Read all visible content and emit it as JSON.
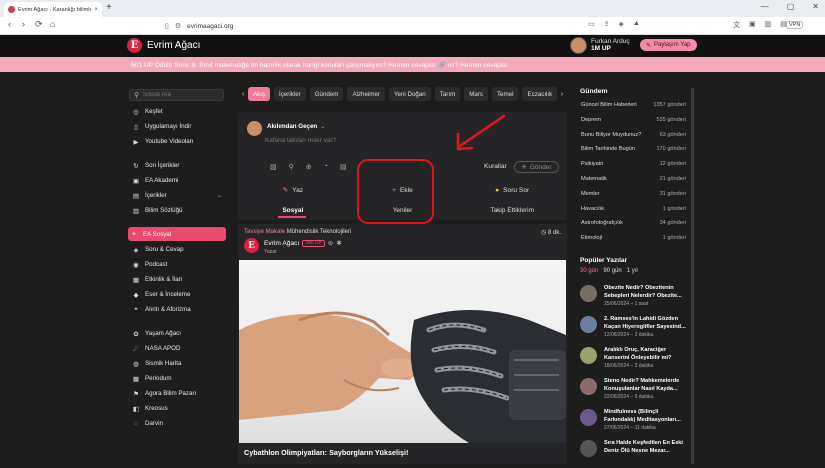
{
  "browser": {
    "tab_title": "Evrim Ağacı - Karanlığı bilimle !",
    "url": "evrimaagaci.org",
    "vpn": "VPN",
    "close": "×",
    "new_tab": "+",
    "back": "‹",
    "forward": "›",
    "reload": "⟳",
    "home": "⌂",
    "min": "—",
    "max": "▢",
    "winclose": "✕"
  },
  "header": {
    "logo_letter": "E",
    "site_name": "Evrim Ağacı",
    "user_name": "Furkan Arduç",
    "user_up": "1M UP",
    "share_button": "Paylaşım Yap"
  },
  "banner": {
    "text": "501 UP Ödülü Soru: 9. Sınıf matematiğe ön hazırlık olarak hangi konuları çalışmalıyım? Hemen cevapla! 🔗 ıcı? Hemen cevapla!"
  },
  "sidebar": {
    "search_placeholder": "Sitede Ara",
    "items": [
      {
        "label": "Keşfet",
        "icon": "◎"
      },
      {
        "label": "Uygulamayı İndir",
        "icon": "▯"
      },
      {
        "label": "Youtube Videoları",
        "icon": "▶"
      },
      {
        "label": "Son İçerikler",
        "icon": "↻"
      },
      {
        "label": "EA Akademi",
        "icon": "▣"
      },
      {
        "label": "İçerikler",
        "icon": "▤"
      },
      {
        "label": "Bilim Sözlüğü",
        "icon": "▥"
      },
      {
        "label": "EA Sosyal",
        "icon": "✦"
      },
      {
        "label": "Soru & Cevap",
        "icon": "◈"
      },
      {
        "label": "Podcast",
        "icon": "◉"
      },
      {
        "label": "Etkinlik & İlan",
        "icon": "▦"
      },
      {
        "label": "Eser & İnceleme",
        "icon": "◆"
      },
      {
        "label": "Alıntı & Aforizma",
        "icon": "❝"
      },
      {
        "label": "Yaşam Ağacı",
        "icon": "✿"
      },
      {
        "label": "NASA APOD",
        "icon": "☄"
      },
      {
        "label": "Sismik Harita",
        "icon": "◍"
      },
      {
        "label": "Periodum",
        "icon": "▩"
      },
      {
        "label": "Agora Bilim Pazarı",
        "icon": "⚑"
      },
      {
        "label": "Kreosus",
        "icon": "◧"
      },
      {
        "label": "Darvin",
        "icon": "◌"
      }
    ],
    "chevron": "⌄"
  },
  "categories": {
    "items": [
      "Akış",
      "İçerikler",
      "Gündem",
      "Alzheimer",
      "Yeni Doğan",
      "Tarım",
      "Mars",
      "Temel",
      "Eczacılık"
    ],
    "prev": "‹",
    "next": "›"
  },
  "composer": {
    "audience": "Akılımdan Geçen",
    "audience_chevron": "⌄",
    "placeholder": "Kafana takılan neler var?",
    "tool_icons": [
      "▨",
      "⚲",
      "⊕",
      "◔",
      "▤"
    ],
    "rules": "Kurallar",
    "send": "Gönder",
    "send_icon": "✈",
    "actions": [
      {
        "icon": "✎",
        "label": "Yaz"
      },
      {
        "icon": "+",
        "label": "Ekle"
      },
      {
        "icon": "●",
        "label": "Soru Sor"
      }
    ],
    "tabs": [
      "Sosyal",
      "Yeniler",
      "Takip Ettiklerim"
    ]
  },
  "post": {
    "type": "Tavsiye Makale",
    "topic": "Mühendislik Teknolojileri",
    "time": "8 dk.",
    "time_icon": "◷",
    "author": "Evrim Ağacı",
    "author_up": "29K UP",
    "role": "Yazar",
    "title": "Cybathlon Olimpiyatları: Sayborgların Yükselişi!"
  },
  "trends": {
    "title": "Gündem",
    "items": [
      {
        "name": "Güncel Bilim Haberleri",
        "count": "1357 gönderi"
      },
      {
        "name": "Deprem",
        "count": "535 gönderi"
      },
      {
        "name": "Bunu Biliyor Muydunuz?",
        "count": "63 gönderi"
      },
      {
        "name": "Bilim Tarihinde Bugün",
        "count": "170 gönderi"
      },
      {
        "name": "Psikiyatri",
        "count": "12 gönderi"
      },
      {
        "name": "Matematik",
        "count": "21 gönderi"
      },
      {
        "name": "Memler",
        "count": "31 gönderi"
      },
      {
        "name": "Havacılık",
        "count": "1 gönderi"
      },
      {
        "name": "Astrofotoğrafçılık",
        "count": "34 gönderi"
      },
      {
        "name": "Etimoloji",
        "count": "1 gönderi"
      }
    ]
  },
  "popular": {
    "title": "Popüler Yazılar",
    "tabs": [
      "30 gün",
      "90 gün",
      "1 yıl"
    ],
    "items": [
      {
        "title": "Obezite Nedir? Obezitenin Sebepleri Nelerdir? Obezite...",
        "meta": "25/06/2024 – 1 saat",
        "color": "#7a6d63"
      },
      {
        "title": "2. Ramses'in Lahidi Gözden Kaçan Hiyeroglifler Sayesind...",
        "meta": "12/06/2024 – 2 dakika",
        "color": "#6b7f9a"
      },
      {
        "title": "Aralıklı Oruç, Karaciğer Kanserini Önleyebilir mi?",
        "meta": "18/06/2024 – 2 dakika",
        "color": "#9aa06e"
      },
      {
        "title": "Steno Nedir? Mahkemelerde Konuşulanlar Nasıl Kayda...",
        "meta": "22/06/2024 – 9 dakika",
        "color": "#8a6d6a"
      },
      {
        "title": "Mindfulness (Bilinçli Farkındalık) Meditasyonları...",
        "meta": "27/06/2024 – 11 dakika",
        "color": "#6e5a8a"
      },
      {
        "title": "Sıra Halde Keşfedilen En Eski Deniz Ölü Nesne Mezar...",
        "meta": "",
        "color": "#555555"
      }
    ]
  }
}
